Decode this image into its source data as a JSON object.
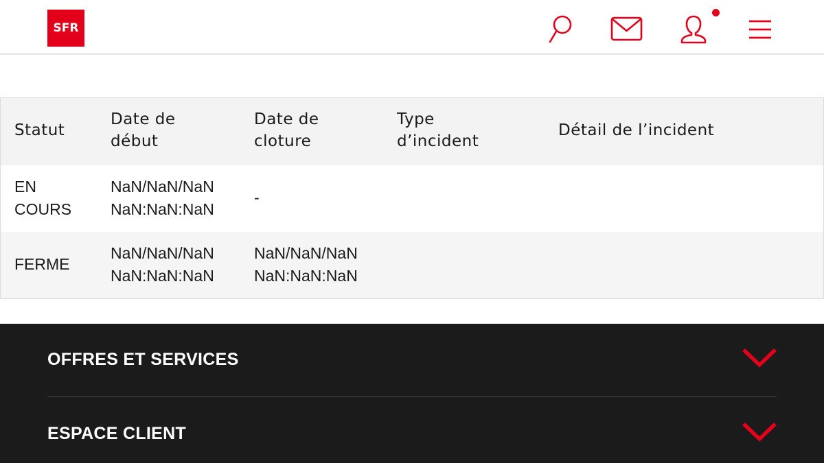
{
  "header": {
    "logo_text": "SFR",
    "icons": [
      "search-icon",
      "mail-icon",
      "user-icon",
      "menu-icon"
    ],
    "brand_color": "#e2001a"
  },
  "table": {
    "columns": [
      "Statut",
      "Date de\ndébut",
      "Date de\ncloture",
      "Type\nd’incident",
      "Détail de l’incident"
    ],
    "rows": [
      {
        "statut": "EN\nCOURS",
        "date_debut": "NaN/NaN/NaN\nNaN:NaN:NaN",
        "date_cloture": "-",
        "type": "",
        "detail": ""
      },
      {
        "statut": "FERME",
        "date_debut": "NaN/NaN/NaN\nNaN:NaN:NaN",
        "date_cloture": "NaN/NaN/NaN\nNaN:NaN:NaN",
        "type": "",
        "detail": ""
      }
    ]
  },
  "footer": {
    "sections": [
      "OFFRES ET SERVICES",
      "ESPACE CLIENT"
    ],
    "accent_color": "#e2001a",
    "background": "#1b1b1b"
  }
}
